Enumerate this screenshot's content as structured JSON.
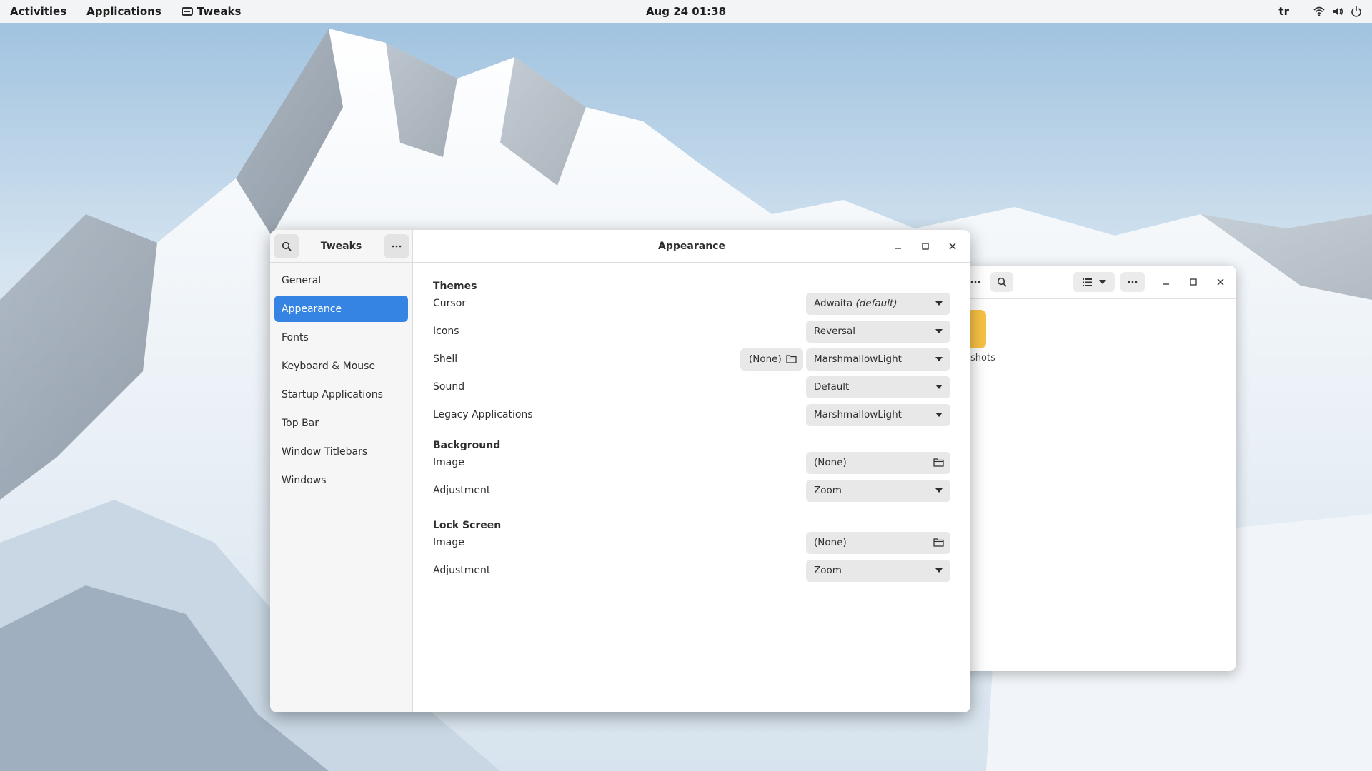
{
  "topbar": {
    "activities": "Activities",
    "applications": "Applications",
    "app_name": "Tweaks",
    "clock": "Aug 24  01:38",
    "keyboard_layout": "tr"
  },
  "files_window": {
    "folder_label": "shots"
  },
  "tweaks": {
    "sidebar_title": "Tweaks",
    "page_title": "Appearance",
    "sidebar_items": [
      {
        "label": "General"
      },
      {
        "label": "Appearance",
        "active": true
      },
      {
        "label": "Fonts"
      },
      {
        "label": "Keyboard & Mouse"
      },
      {
        "label": "Startup Applications"
      },
      {
        "label": "Top Bar"
      },
      {
        "label": "Window Titlebars"
      },
      {
        "label": "Windows"
      }
    ],
    "themes": {
      "title": "Themes",
      "cursor_label": "Cursor",
      "cursor_value": "Adwaita",
      "cursor_value_suffix": "(default)",
      "icons_label": "Icons",
      "icons_value": "Reversal",
      "shell_label": "Shell",
      "shell_file_value": "(None)",
      "shell_value": "MarshmallowLight",
      "sound_label": "Sound",
      "sound_value": "Default",
      "legacy_label": "Legacy Applications",
      "legacy_value": "MarshmallowLight"
    },
    "background": {
      "title": "Background",
      "image_label": "Image",
      "image_value": "(None)",
      "adjustment_label": "Adjustment",
      "adjustment_value": "Zoom"
    },
    "lock_screen": {
      "title": "Lock Screen",
      "image_label": "Image",
      "image_value": "(None)",
      "adjustment_label": "Adjustment",
      "adjustment_value": "Zoom"
    }
  },
  "colors": {
    "accent": "#3584e4",
    "folder": "#f8c244"
  }
}
